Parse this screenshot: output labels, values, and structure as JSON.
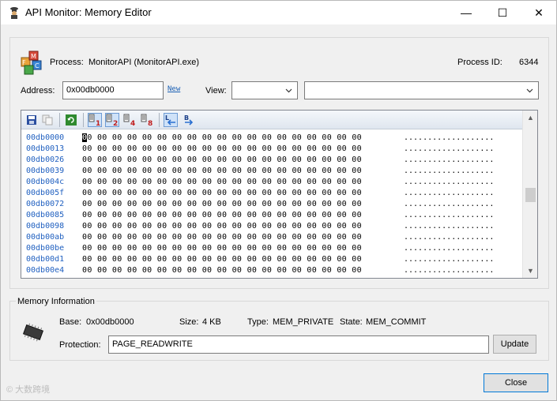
{
  "window": {
    "title": "API Monitor: Memory Editor",
    "controls": {
      "minimize": "—",
      "maximize": "☐",
      "close": "✕"
    }
  },
  "process": {
    "label": "Process:",
    "value": "MonitorAPI (MonitorAPI.exe)",
    "pid_label": "Process ID:",
    "pid_value": "6344"
  },
  "address": {
    "label": "Address:",
    "value": "0x00db0000",
    "new_link": "New"
  },
  "view": {
    "label": "View:",
    "combo1_value": "",
    "combo2_value": ""
  },
  "toolbar": {
    "items": [
      "save",
      "copy",
      "refresh",
      "1",
      "2",
      "4",
      "8",
      "L",
      "B"
    ]
  },
  "hex": {
    "rows": [
      {
        "addr": "00db0000",
        "bytes": "00 00 00 00 00 00 00 00 00 00 00 00 00 00 00 00 00 00 00",
        "ascii": "..................."
      },
      {
        "addr": "00db0013",
        "bytes": "00 00 00 00 00 00 00 00 00 00 00 00 00 00 00 00 00 00 00",
        "ascii": "..................."
      },
      {
        "addr": "00db0026",
        "bytes": "00 00 00 00 00 00 00 00 00 00 00 00 00 00 00 00 00 00 00",
        "ascii": "..................."
      },
      {
        "addr": "00db0039",
        "bytes": "00 00 00 00 00 00 00 00 00 00 00 00 00 00 00 00 00 00 00",
        "ascii": "..................."
      },
      {
        "addr": "00db004c",
        "bytes": "00 00 00 00 00 00 00 00 00 00 00 00 00 00 00 00 00 00 00",
        "ascii": "..................."
      },
      {
        "addr": "00db005f",
        "bytes": "00 00 00 00 00 00 00 00 00 00 00 00 00 00 00 00 00 00 00",
        "ascii": "..................."
      },
      {
        "addr": "00db0072",
        "bytes": "00 00 00 00 00 00 00 00 00 00 00 00 00 00 00 00 00 00 00",
        "ascii": "..................."
      },
      {
        "addr": "00db0085",
        "bytes": "00 00 00 00 00 00 00 00 00 00 00 00 00 00 00 00 00 00 00",
        "ascii": "..................."
      },
      {
        "addr": "00db0098",
        "bytes": "00 00 00 00 00 00 00 00 00 00 00 00 00 00 00 00 00 00 00",
        "ascii": "..................."
      },
      {
        "addr": "00db00ab",
        "bytes": "00 00 00 00 00 00 00 00 00 00 00 00 00 00 00 00 00 00 00",
        "ascii": "..................."
      },
      {
        "addr": "00db00be",
        "bytes": "00 00 00 00 00 00 00 00 00 00 00 00 00 00 00 00 00 00 00",
        "ascii": "..................."
      },
      {
        "addr": "00db00d1",
        "bytes": "00 00 00 00 00 00 00 00 00 00 00 00 00 00 00 00 00 00 00",
        "ascii": "..................."
      },
      {
        "addr": "00db00e4",
        "bytes": "00 00 00 00 00 00 00 00 00 00 00 00 00 00 00 00 00 00 00",
        "ascii": "..................."
      }
    ]
  },
  "memory_info": {
    "title": "Memory Information",
    "base_label": "Base:",
    "base_value": "0x00db0000",
    "size_label": "Size:",
    "size_value": "4 KB",
    "type_label": "Type:",
    "type_value": "MEM_PRIVATE",
    "state_label": "State:",
    "state_value": "MEM_COMMIT",
    "protection_label": "Protection:",
    "protection_value": "PAGE_READWRITE",
    "update_button": "Update"
  },
  "close_button": "Close",
  "watermark": "© 大数跨境",
  "colors": {
    "address_text": "#2060c0",
    "link": "#1a5fb4"
  }
}
